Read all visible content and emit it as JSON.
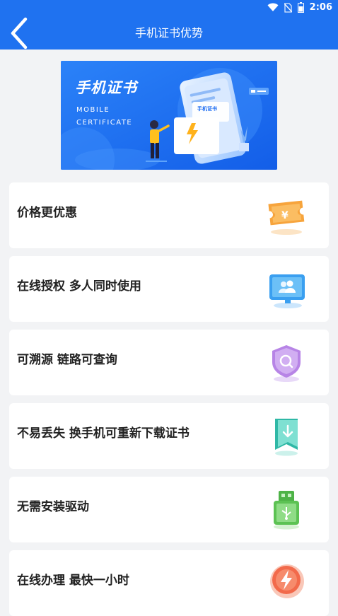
{
  "status": {
    "time": "2:06"
  },
  "header": {
    "title": "手机证书优势"
  },
  "banner": {
    "title": "手机证书",
    "subtitle_line1": "MOBILE",
    "subtitle_line2": "CERTIFICATE",
    "phone_label": "手机证书"
  },
  "advantages": [
    {
      "label": "价格更优惠",
      "icon": "yuan-ticket-icon",
      "color": "#f5a03a"
    },
    {
      "label": "在线授权 多人同时使用",
      "icon": "multi-user-screen-icon",
      "color": "#3ca2ec"
    },
    {
      "label": "可溯源 链路可查询",
      "icon": "search-shield-icon",
      "color": "#b07ee0"
    },
    {
      "label": "不易丢失 换手机可重新下载证书",
      "icon": "download-bookmark-icon",
      "color": "#3fc6b5"
    },
    {
      "label": "无需安装驱动",
      "icon": "usb-drive-icon",
      "color": "#5cc253"
    },
    {
      "label": "在线办理 最快一小时",
      "icon": "lightning-badge-icon",
      "color": "#f26a4b"
    }
  ]
}
